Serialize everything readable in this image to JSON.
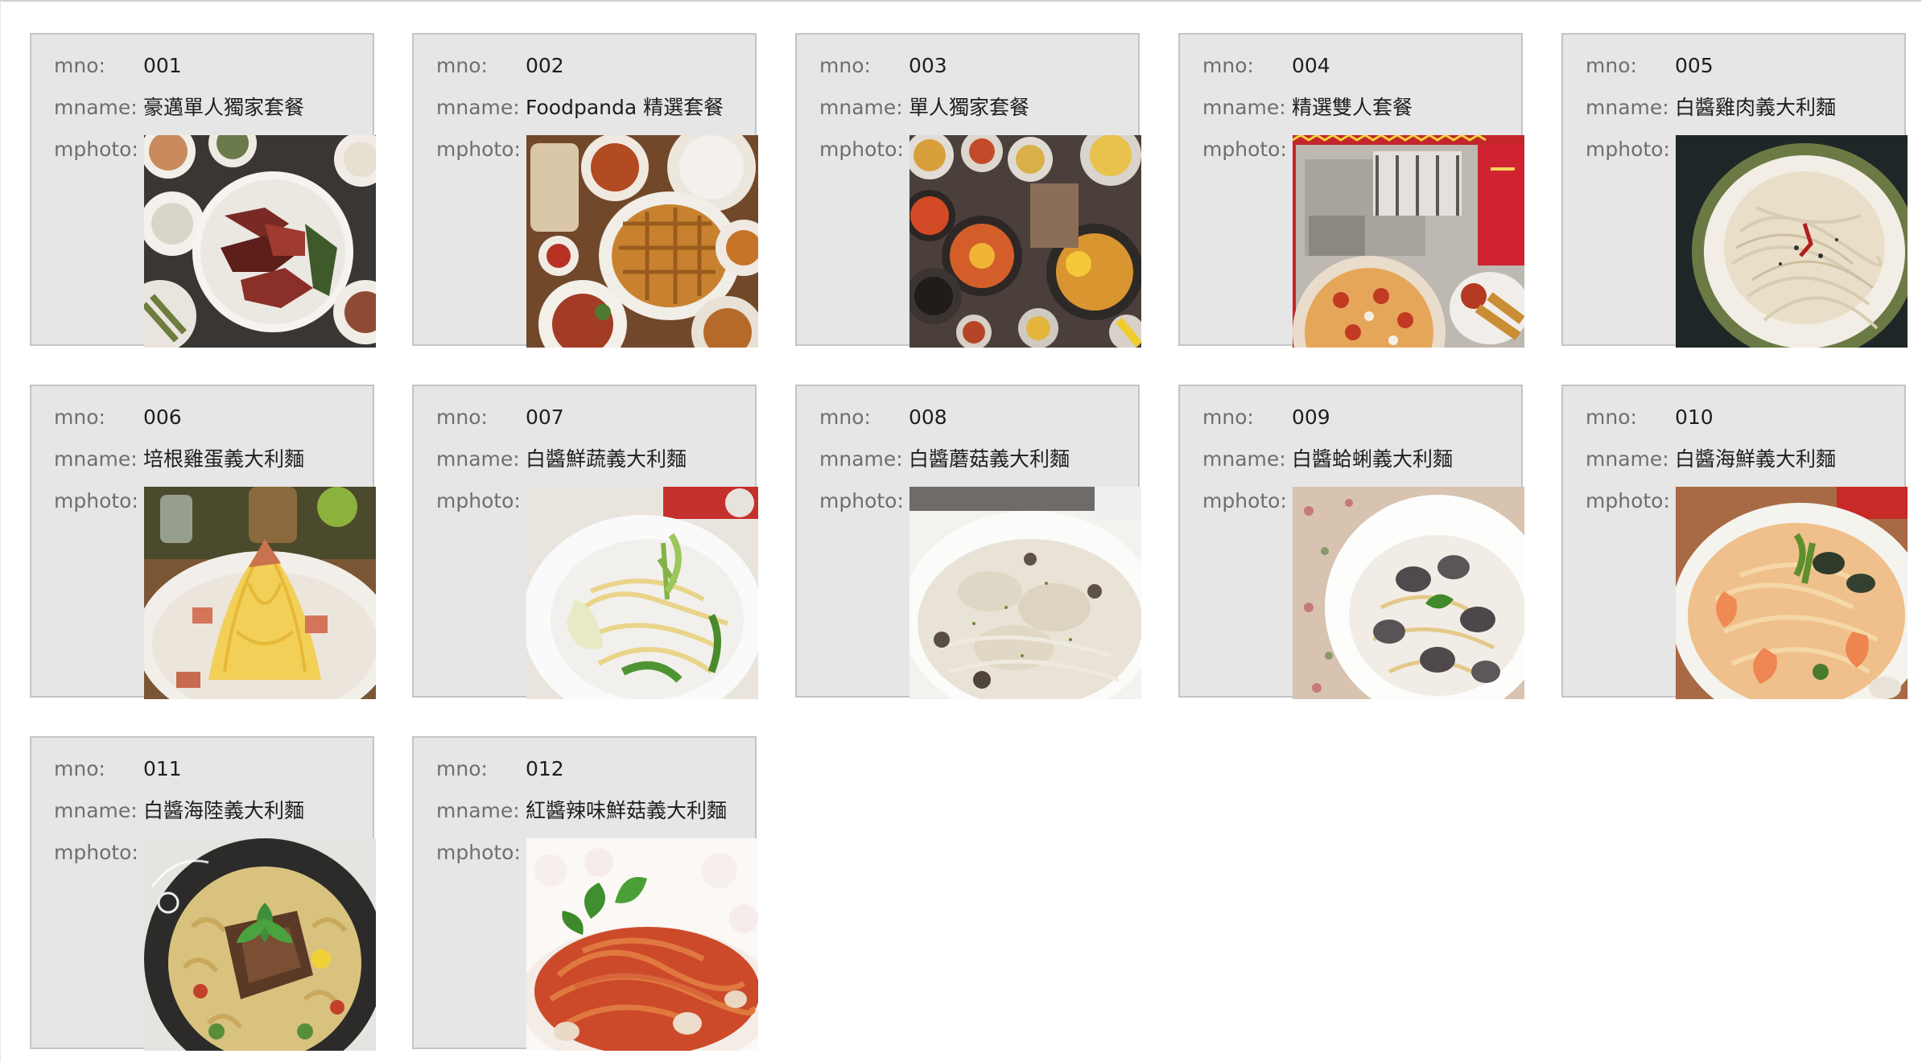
{
  "labels": {
    "mno": "mno:",
    "mname": "mname:",
    "mphoto": "mphoto:"
  },
  "items": [
    {
      "mno": "001",
      "mname": "豪邁單人獨家套餐",
      "photo_icon": "steak-platter-photo"
    },
    {
      "mno": "002",
      "mname": "Foodpanda 精選套餐",
      "photo_icon": "waffle-feast-photo"
    },
    {
      "mno": "003",
      "mname": "單人獨家套餐",
      "photo_icon": "hotpot-spread-photo"
    },
    {
      "mno": "004",
      "mname": "精選雙人套餐",
      "photo_icon": "pizza-restaurant-photo"
    },
    {
      "mno": "005",
      "mname": "白醬雞肉義大利麵",
      "photo_icon": "chicken-cream-pasta-photo"
    },
    {
      "mno": "006",
      "mname": "培根雞蛋義大利麵",
      "photo_icon": "carbonara-photo"
    },
    {
      "mno": "007",
      "mname": "白醬鮮蔬義大利麵",
      "photo_icon": "vegetable-pasta-photo"
    },
    {
      "mno": "008",
      "mname": "白醬蘑菇義大利麵",
      "photo_icon": "mushroom-cream-pasta-photo"
    },
    {
      "mno": "009",
      "mname": "白醬蛤蜊義大利麵",
      "photo_icon": "clam-pasta-photo"
    },
    {
      "mno": "010",
      "mname": "白醬海鮮義大利麵",
      "photo_icon": "seafood-pasta-photo"
    },
    {
      "mno": "011",
      "mname": "白醬海陸義大利麵",
      "photo_icon": "surf-turf-pasta-photo"
    },
    {
      "mno": "012",
      "mname": "紅醬辣味鮮菇義大利麵",
      "photo_icon": "tomato-spicy-pasta-photo"
    }
  ],
  "colors": {
    "card_bg": "#e6e6e6",
    "card_border": "#c4c4c4",
    "label_text": "#6f6f6f",
    "value_text": "#1e1e1e"
  }
}
